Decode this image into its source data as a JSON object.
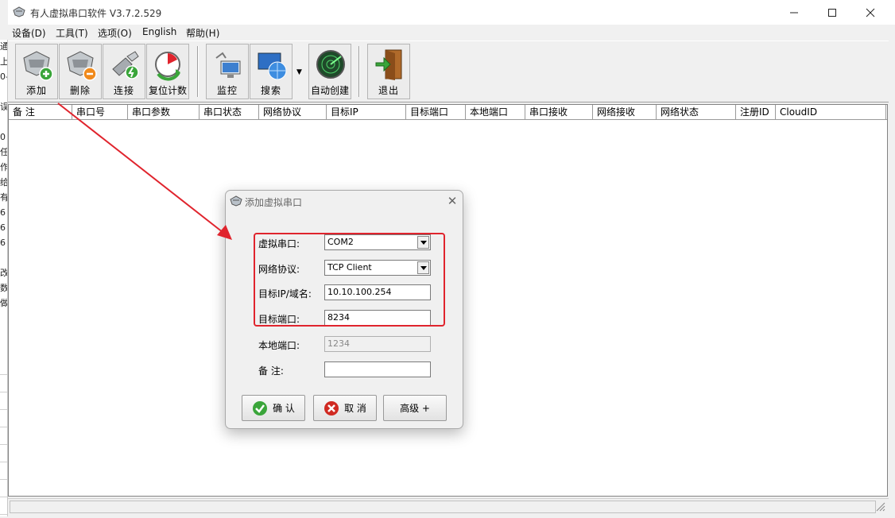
{
  "background_window": {
    "chars": [
      "通",
      "上",
      "0-",
      "",
      "误",
      "",
      "0",
      "任",
      "作",
      "给",
      "有",
      "6",
      "6",
      "6",
      "",
      "改",
      "数",
      "做"
    ]
  },
  "window": {
    "title": "有人虚拟串口软件 V3.7.2.529",
    "controls": {
      "minimize": "—",
      "maximize": "☐",
      "close": "✕"
    }
  },
  "menu": [
    "设备(D)",
    "工具(T)",
    "选项(O)",
    "English",
    "帮助(H)"
  ],
  "toolbar": {
    "add": "添加",
    "delete": "删除",
    "connect": "连接",
    "reset_count": "复位计数",
    "monitor": "监控",
    "search": "搜索",
    "auto_create": "自动创建",
    "exit": "退出",
    "search_dropdown": "▼"
  },
  "columns": [
    "备 注",
    "串口号",
    "串口参数",
    "串口状态",
    "网络协议",
    "目标IP",
    "目标端口",
    "本地端口",
    "串口接收",
    "网络接收",
    "网络状态",
    "注册ID",
    "CloudID"
  ],
  "dialog": {
    "title": "添加虚拟串口",
    "close": "✕",
    "fields": {
      "virtual_port": {
        "label": "虚拟串口:",
        "value": "COM2"
      },
      "protocol": {
        "label": "网络协议:",
        "value": "TCP Client"
      },
      "target_ip": {
        "label": "目标IP/域名:",
        "value": "10.10.100.254"
      },
      "target_port": {
        "label": "目标端口:",
        "value": "8234"
      },
      "local_port": {
        "label": "本地端口:",
        "value": "1234"
      },
      "remark": {
        "label": "备 注:",
        "value": ""
      }
    },
    "buttons": {
      "ok": "确 认",
      "cancel": "取 消",
      "advanced": "高级 +"
    }
  },
  "annotation_color": "#e0242d"
}
